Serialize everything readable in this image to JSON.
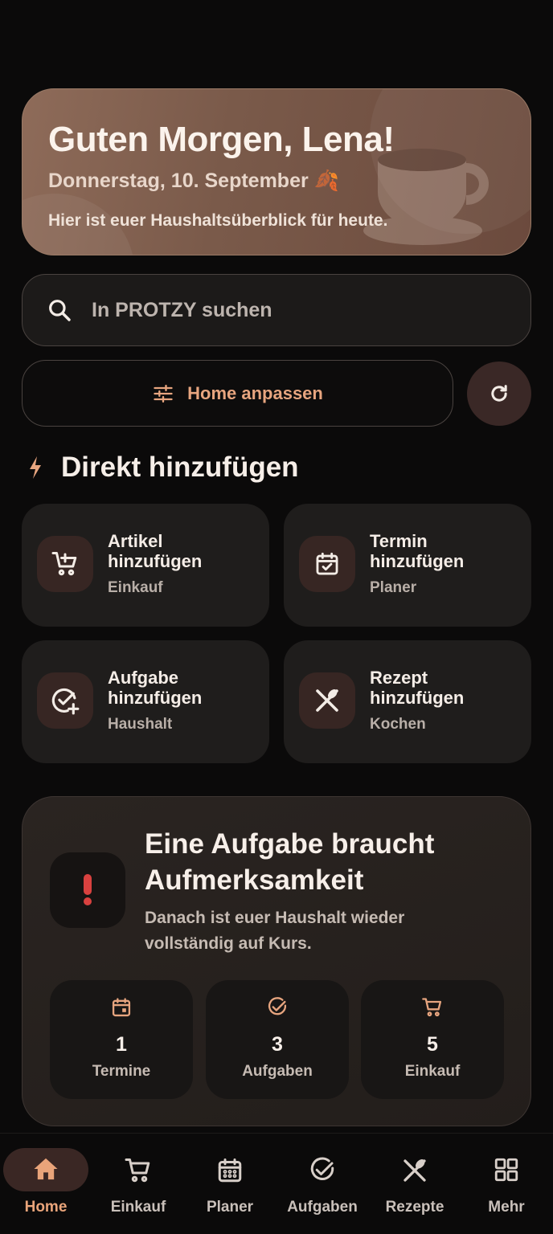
{
  "greeting": {
    "title": "Guten Morgen, Lena!",
    "date": "Donnerstag, 10. September 🍂",
    "subtitle": "Hier ist euer Haushaltsüberblick für heute."
  },
  "search": {
    "placeholder": "In PROTZY suchen",
    "icon": "search-icon"
  },
  "customize": {
    "label": "Home anpassen",
    "icon": "tune-icon"
  },
  "refresh": {
    "icon": "refresh-icon"
  },
  "quick_add": {
    "title": "Direkt hinzufügen",
    "icon": "bolt-icon",
    "items": [
      {
        "title": "Artikel hinzufügen",
        "subtitle": "Einkauf",
        "icon": "add-cart-icon"
      },
      {
        "title": "Termin hinzufügen",
        "subtitle": "Planer",
        "icon": "calendar-check-icon"
      },
      {
        "title": "Aufgabe hinzufügen",
        "subtitle": "Haushalt",
        "icon": "task-add-icon"
      },
      {
        "title": "Rezept hinzufügen",
        "subtitle": "Kochen",
        "icon": "utensils-icon"
      }
    ]
  },
  "attention": {
    "heading": "Eine Aufgabe braucht Aufmerksamkeit",
    "description": "Danach ist euer Haushalt wieder vollständig auf Kurs.",
    "icon": "exclamation-icon",
    "stats": [
      {
        "value": "1",
        "label": "Termine",
        "icon": "calendar-icon"
      },
      {
        "value": "3",
        "label": "Aufgaben",
        "icon": "check-circle-icon"
      },
      {
        "value": "5",
        "label": "Einkauf",
        "icon": "cart-icon"
      }
    ]
  },
  "nav": {
    "items": [
      {
        "label": "Home",
        "icon": "home-icon",
        "active": true
      },
      {
        "label": "Einkauf",
        "icon": "cart-icon"
      },
      {
        "label": "Planer",
        "icon": "calendar-icon"
      },
      {
        "label": "Aufgaben",
        "icon": "check-circle-icon"
      },
      {
        "label": "Rezepte",
        "icon": "utensils-icon"
      },
      {
        "label": "Mehr",
        "icon": "grid-icon"
      }
    ]
  },
  "colors": {
    "background": "#0b0a0a",
    "accent": "#e9a47a",
    "card": "#1f1d1c",
    "alert": "#d9413f"
  }
}
